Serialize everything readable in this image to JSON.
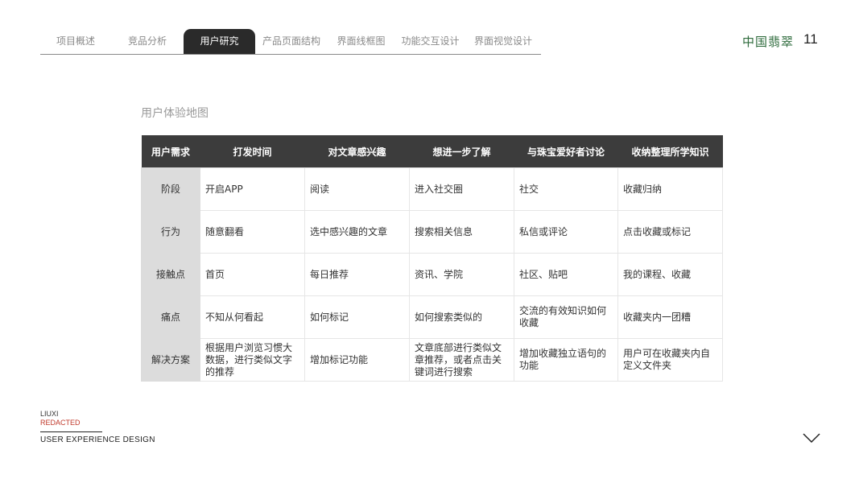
{
  "nav": {
    "tabs": [
      {
        "label": "项目概述",
        "active": false
      },
      {
        "label": "竞品分析",
        "active": false
      },
      {
        "label": "用户研究",
        "active": true
      },
      {
        "label": "产品页面结构",
        "active": false
      },
      {
        "label": "界面线框图",
        "active": false
      },
      {
        "label": "功能交互设计",
        "active": false
      },
      {
        "label": "界面视觉设计",
        "active": false
      }
    ]
  },
  "brand": "中国翡翠",
  "page_number": "11",
  "section_title": "用户体验地图",
  "table": {
    "headers": [
      "用户需求",
      "打发时间",
      "对文章感兴趣",
      "想进一步了解",
      "与珠宝爱好者讨论",
      "收纳整理所学知识"
    ],
    "rows": [
      {
        "label": "阶段",
        "cells": [
          "开启APP",
          "阅读",
          "进入社交圈",
          "社交",
          "收藏归纳"
        ]
      },
      {
        "label": "行为",
        "cells": [
          "随意翻看",
          "选中感兴趣的文章",
          "搜索相关信息",
          "私信或评论",
          "点击收藏或标记"
        ]
      },
      {
        "label": "接触点",
        "cells": [
          "首页",
          "每日推荐",
          "资讯、学院",
          "社区、贴吧",
          "我的课程、收藏"
        ]
      },
      {
        "label": "痛点",
        "cells": [
          "不知从何看起",
          "如何标记",
          "如何搜索类似的",
          "交流的有效知识如何收藏",
          "收藏夹内一团糟"
        ]
      },
      {
        "label": "解决方案",
        "cells": [
          "根据用户浏览习惯大数据，进行类似文字的推荐",
          "增加标记功能",
          "文章底部进行类似文章推荐，或者点击关键词进行搜索",
          "增加收藏独立语句的功能",
          "用户可在收藏夹内自定义文件夹"
        ]
      }
    ]
  },
  "footer": {
    "name_line1": "LIUXI",
    "name_line2": "REDACTED",
    "label": "USER EXPERIENCE DESIGN"
  },
  "colors": {
    "active_tab": "#2a2a2a",
    "brand": "#2e6b3c",
    "table_header": "#3c3c3c",
    "row_head": "#dcdcdc",
    "accent_red": "#c0392b"
  },
  "icons": {
    "next_page": "chevron-down-icon"
  }
}
